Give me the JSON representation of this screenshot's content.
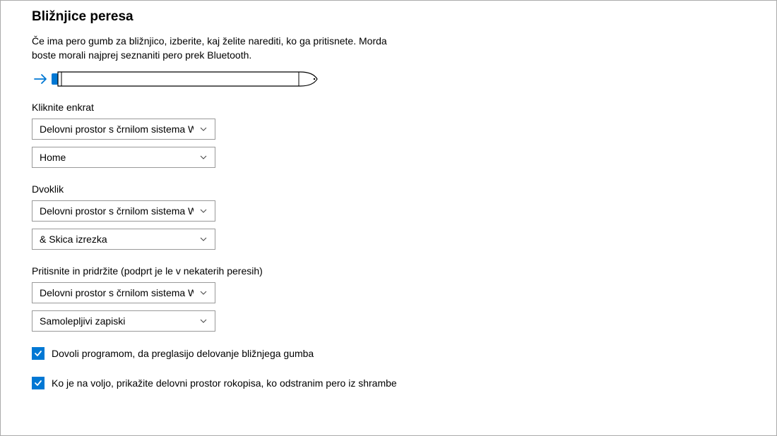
{
  "header": {
    "title": "Bližnjice peresa",
    "description": "Če ima pero gumb za bližnjico, izberite, kaj želite narediti, ko ga pritisnete. Morda boste morali najprej seznaniti pero prek Bluetooth."
  },
  "sections": {
    "click_once": {
      "label": "Kliknite enkrat",
      "primary_select": "Delovni prostor s črnilom sistema Windows",
      "secondary_select": "Home"
    },
    "double_click": {
      "label": "Dvoklik",
      "primary_select": "Delovni prostor s črnilom sistema Windows",
      "secondary_select": "& Skica izrezka"
    },
    "press_hold": {
      "label": "Pritisnite in pridržite (podprt je le v nekaterih peresih)",
      "primary_select": "Delovni prostor s črnilom sistema Windows",
      "secondary_select": "Samolepljivi zapiski"
    }
  },
  "checkboxes": {
    "allow_override": "Dovoli programom, da preglasijo delovanje bližnjega gumba",
    "show_workspace": "Ko je na voljo, prikažite delovni prostor rokopisa, ko odstranim pero iz shrambe"
  }
}
